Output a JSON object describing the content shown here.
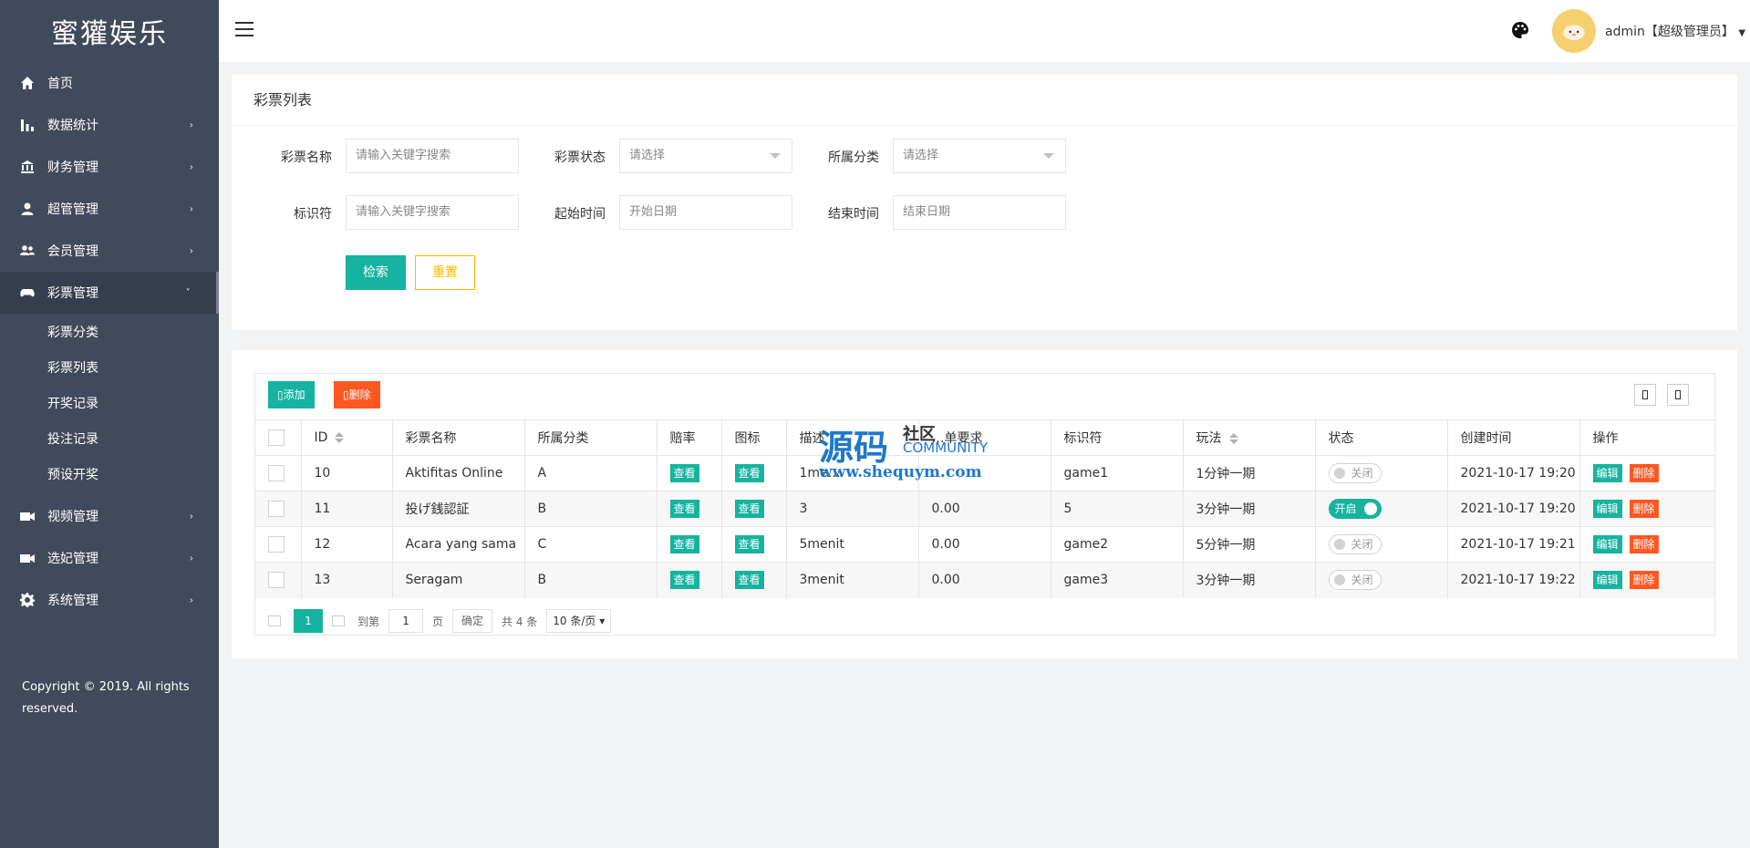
{
  "app": {
    "brand": "蜜獾娱乐"
  },
  "sidebar": {
    "items": [
      {
        "label": "首页",
        "icon": "home-icon"
      },
      {
        "label": "数据统计",
        "icon": "bar-chart-icon"
      },
      {
        "label": "财务管理",
        "icon": "bank-icon"
      },
      {
        "label": "超管管理",
        "icon": "user-icon"
      },
      {
        "label": "会员管理",
        "icon": "users-icon"
      },
      {
        "label": "彩票管理",
        "icon": "gamepad-icon"
      },
      {
        "label": "视频管理",
        "icon": "video-icon"
      },
      {
        "label": "选妃管理",
        "icon": "video-icon"
      },
      {
        "label": "系统管理",
        "icon": "gear-icon"
      }
    ],
    "sub_items": [
      "彩票分类",
      "彩票列表",
      "开奖记录",
      "投注记录",
      "预设开奖"
    ],
    "copyright": "Copyright © 2019. All rights reserved."
  },
  "header": {
    "user": "admin【超级管理员】",
    "avatar_color": "#f6cf6e"
  },
  "filter": {
    "title": "彩票列表",
    "fields": [
      {
        "label": "彩票名称",
        "placeholder": "请输入关键字搜索"
      },
      {
        "label": "彩票状态",
        "placeholder": "请选择"
      },
      {
        "label": "所属分类",
        "placeholder": "请选择"
      },
      {
        "label": "标识符",
        "placeholder": "请输入关键字搜索"
      },
      {
        "label": "起始时间",
        "placeholder": "开始日期"
      },
      {
        "label": "结束时间",
        "placeholder": "结束日期"
      }
    ],
    "search_label": "检索",
    "reset_label": "重置"
  },
  "toolbar": {
    "add_label": "添加",
    "delete_label": "删除"
  },
  "table": {
    "headers": [
      "ID",
      "彩票名称",
      "所属分类",
      "赔率",
      "图标",
      "描述",
      "…单要求",
      "标识符",
      "玩法",
      "状态",
      "创建时间",
      "操作"
    ],
    "view_label": "查看",
    "edit_label": "编辑",
    "delete_label": "删除",
    "switch_on": "开启",
    "switch_off": "关闭",
    "rows": [
      {
        "id": "10",
        "name": "Aktifitas Online",
        "category": "A",
        "desc": "1me…",
        "req": "…",
        "ident": "game1",
        "play": "1分钟一期",
        "on": false,
        "created": "2021-10-17 19:20"
      },
      {
        "id": "11",
        "name": "投げ銭認証",
        "category": "B",
        "desc": "3",
        "req": "0.00",
        "ident": "5",
        "play": "3分钟一期",
        "on": true,
        "created": "2021-10-17 19:20"
      },
      {
        "id": "12",
        "name": "Acara yang sama",
        "category": "C",
        "desc": "5menit",
        "req": "0.00",
        "ident": "game2",
        "play": "5分钟一期",
        "on": false,
        "created": "2021-10-17 19:21"
      },
      {
        "id": "13",
        "name": "Seragam",
        "category": "B",
        "desc": "3menit",
        "req": "0.00",
        "ident": "game3",
        "play": "3分钟一期",
        "on": false,
        "created": "2021-10-17 19:22"
      }
    ]
  },
  "pager": {
    "current": "1",
    "goto_label": "到第",
    "goto_value": "1",
    "page_unit": "页",
    "confirm": "确定",
    "total": "共 4 条",
    "page_size": "10 条/页"
  },
  "watermark": {
    "big": "源码",
    "small1": "社区",
    "small2": "COMMUNITY",
    "url": "www.shequym.com"
  },
  "colors": {
    "accent": "#16b3a0",
    "danger": "#ff5722",
    "warn": "#ffb800",
    "sidebar": "#414a5b"
  }
}
